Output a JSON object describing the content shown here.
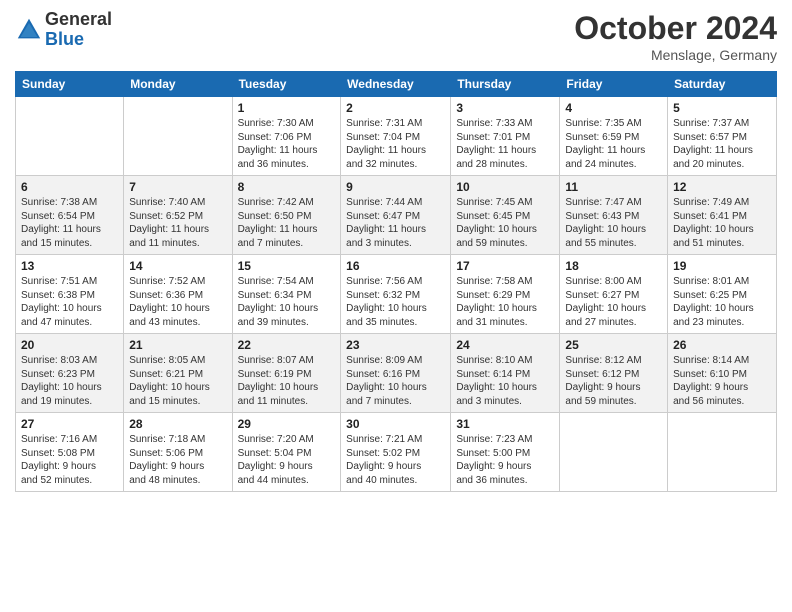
{
  "logo": {
    "general": "General",
    "blue": "Blue"
  },
  "header": {
    "month": "October 2024",
    "location": "Menslage, Germany"
  },
  "days_of_week": [
    "Sunday",
    "Monday",
    "Tuesday",
    "Wednesday",
    "Thursday",
    "Friday",
    "Saturday"
  ],
  "weeks": [
    [
      {
        "day": "",
        "content": ""
      },
      {
        "day": "",
        "content": ""
      },
      {
        "day": "1",
        "content": "Sunrise: 7:30 AM\nSunset: 7:06 PM\nDaylight: 11 hours\nand 36 minutes."
      },
      {
        "day": "2",
        "content": "Sunrise: 7:31 AM\nSunset: 7:04 PM\nDaylight: 11 hours\nand 32 minutes."
      },
      {
        "day": "3",
        "content": "Sunrise: 7:33 AM\nSunset: 7:01 PM\nDaylight: 11 hours\nand 28 minutes."
      },
      {
        "day": "4",
        "content": "Sunrise: 7:35 AM\nSunset: 6:59 PM\nDaylight: 11 hours\nand 24 minutes."
      },
      {
        "day": "5",
        "content": "Sunrise: 7:37 AM\nSunset: 6:57 PM\nDaylight: 11 hours\nand 20 minutes."
      }
    ],
    [
      {
        "day": "6",
        "content": "Sunrise: 7:38 AM\nSunset: 6:54 PM\nDaylight: 11 hours\nand 15 minutes."
      },
      {
        "day": "7",
        "content": "Sunrise: 7:40 AM\nSunset: 6:52 PM\nDaylight: 11 hours\nand 11 minutes."
      },
      {
        "day": "8",
        "content": "Sunrise: 7:42 AM\nSunset: 6:50 PM\nDaylight: 11 hours\nand 7 minutes."
      },
      {
        "day": "9",
        "content": "Sunrise: 7:44 AM\nSunset: 6:47 PM\nDaylight: 11 hours\nand 3 minutes."
      },
      {
        "day": "10",
        "content": "Sunrise: 7:45 AM\nSunset: 6:45 PM\nDaylight: 10 hours\nand 59 minutes."
      },
      {
        "day": "11",
        "content": "Sunrise: 7:47 AM\nSunset: 6:43 PM\nDaylight: 10 hours\nand 55 minutes."
      },
      {
        "day": "12",
        "content": "Sunrise: 7:49 AM\nSunset: 6:41 PM\nDaylight: 10 hours\nand 51 minutes."
      }
    ],
    [
      {
        "day": "13",
        "content": "Sunrise: 7:51 AM\nSunset: 6:38 PM\nDaylight: 10 hours\nand 47 minutes."
      },
      {
        "day": "14",
        "content": "Sunrise: 7:52 AM\nSunset: 6:36 PM\nDaylight: 10 hours\nand 43 minutes."
      },
      {
        "day": "15",
        "content": "Sunrise: 7:54 AM\nSunset: 6:34 PM\nDaylight: 10 hours\nand 39 minutes."
      },
      {
        "day": "16",
        "content": "Sunrise: 7:56 AM\nSunset: 6:32 PM\nDaylight: 10 hours\nand 35 minutes."
      },
      {
        "day": "17",
        "content": "Sunrise: 7:58 AM\nSunset: 6:29 PM\nDaylight: 10 hours\nand 31 minutes."
      },
      {
        "day": "18",
        "content": "Sunrise: 8:00 AM\nSunset: 6:27 PM\nDaylight: 10 hours\nand 27 minutes."
      },
      {
        "day": "19",
        "content": "Sunrise: 8:01 AM\nSunset: 6:25 PM\nDaylight: 10 hours\nand 23 minutes."
      }
    ],
    [
      {
        "day": "20",
        "content": "Sunrise: 8:03 AM\nSunset: 6:23 PM\nDaylight: 10 hours\nand 19 minutes."
      },
      {
        "day": "21",
        "content": "Sunrise: 8:05 AM\nSunset: 6:21 PM\nDaylight: 10 hours\nand 15 minutes."
      },
      {
        "day": "22",
        "content": "Sunrise: 8:07 AM\nSunset: 6:19 PM\nDaylight: 10 hours\nand 11 minutes."
      },
      {
        "day": "23",
        "content": "Sunrise: 8:09 AM\nSunset: 6:16 PM\nDaylight: 10 hours\nand 7 minutes."
      },
      {
        "day": "24",
        "content": "Sunrise: 8:10 AM\nSunset: 6:14 PM\nDaylight: 10 hours\nand 3 minutes."
      },
      {
        "day": "25",
        "content": "Sunrise: 8:12 AM\nSunset: 6:12 PM\nDaylight: 9 hours\nand 59 minutes."
      },
      {
        "day": "26",
        "content": "Sunrise: 8:14 AM\nSunset: 6:10 PM\nDaylight: 9 hours\nand 56 minutes."
      }
    ],
    [
      {
        "day": "27",
        "content": "Sunrise: 7:16 AM\nSunset: 5:08 PM\nDaylight: 9 hours\nand 52 minutes."
      },
      {
        "day": "28",
        "content": "Sunrise: 7:18 AM\nSunset: 5:06 PM\nDaylight: 9 hours\nand 48 minutes."
      },
      {
        "day": "29",
        "content": "Sunrise: 7:20 AM\nSunset: 5:04 PM\nDaylight: 9 hours\nand 44 minutes."
      },
      {
        "day": "30",
        "content": "Sunrise: 7:21 AM\nSunset: 5:02 PM\nDaylight: 9 hours\nand 40 minutes."
      },
      {
        "day": "31",
        "content": "Sunrise: 7:23 AM\nSunset: 5:00 PM\nDaylight: 9 hours\nand 36 minutes."
      },
      {
        "day": "",
        "content": ""
      },
      {
        "day": "",
        "content": ""
      }
    ]
  ]
}
